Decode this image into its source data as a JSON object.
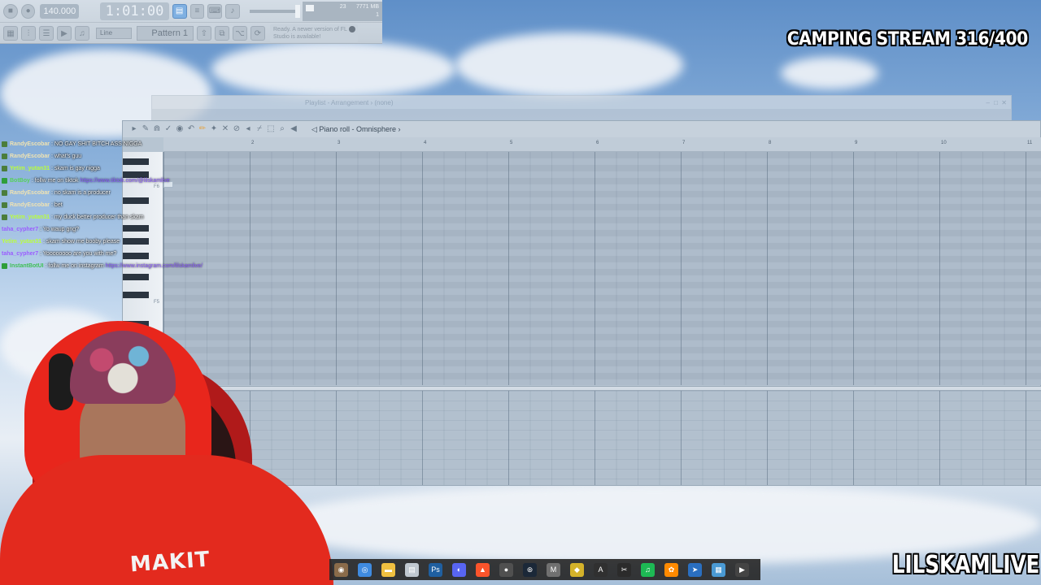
{
  "fl_toolbar": {
    "tempo": "140.000",
    "time": "1:01:00",
    "cpu": "23",
    "ram": "7771 MB",
    "polyphony": "1",
    "snap_mode": "Line",
    "pattern": "Pattern 1",
    "update_notice": "Ready. A newer version of FL Studio is available!"
  },
  "overlay": {
    "stream_title": "CAMPING STREAM 316/400",
    "channel_name": "LILSKAMLIVE"
  },
  "playlist": {
    "title": "Playlist - Arrangement › (none)"
  },
  "piano_roll": {
    "title": "Piano roll - Omnisphere",
    "bars": [
      "2",
      "3",
      "4",
      "5",
      "6",
      "7",
      "8",
      "9",
      "10",
      "11"
    ],
    "key_labels": [
      "F6",
      "F5"
    ]
  },
  "chat": [
    {
      "user": "RandyEscobar",
      "text": ": NO GAY SHIT BITCH ASS NIGGA",
      "color": "#f0e3b2",
      "badge": "#4b7d3c"
    },
    {
      "user": "RandyEscobar",
      "text": ": what's guu",
      "color": "#f0e3b2",
      "badge": "#4b7d3c"
    },
    {
      "user": "Yetim_yutan31",
      "text": ": skam is gay nigga",
      "color": "#b9ff3a",
      "badge": "#4b7d3c"
    },
    {
      "user": "BotBoy",
      "text": ": follw me on tiktok",
      "link": "https://www.tiktok.com/@lilskamlive",
      "color": "#57d15a",
      "badge": "#2f9e3a"
    },
    {
      "user": "RandyEscobar",
      "text": ": no skam is a producer",
      "color": "#f0e3b2",
      "badge": "#4b7d3c"
    },
    {
      "user": "RandyEscobar",
      "text": ": bet",
      "color": "#f0e3b2",
      "badge": "#4b7d3c"
    },
    {
      "user": "Yetim_yutan31",
      "text": ": my duck better producer than skam",
      "color": "#b9ff3a",
      "badge": "#4b7d3c"
    },
    {
      "user": "taha_cypher7",
      "text": ": Yo waup gng?",
      "color": "#9b5cff",
      "badge": ""
    },
    {
      "user": "Yetim_yutan31",
      "text": ": skam show me booby please",
      "color": "#b9ff3a",
      "badge": ""
    },
    {
      "user": "taha_cypher7",
      "text": ": Yoooooooo are you with me?",
      "color": "#9b5cff",
      "badge": ""
    },
    {
      "user": "InstantBotUI",
      "text": ": follw me on instagram",
      "link": "https://www.instagram.com/lilskamlive/",
      "color": "#3fbf55",
      "badge": "#2f9e3a"
    }
  ],
  "webcam": {
    "shirt_text": "MAKIT"
  },
  "taskbar": {
    "icons": [
      "explorer-icon",
      "chrome-icon",
      "folder-icon",
      "clipboard-icon",
      "photoshop-icon",
      "discord-icon",
      "brave-icon",
      "obs-icon",
      "steam-icon",
      "mxp-icon",
      "stack-icon",
      "ableton-icon",
      "cut-icon",
      "spotify-icon",
      "fl-studio-icon",
      "arrow-icon",
      "notepad-icon",
      "media-player-icon"
    ]
  }
}
